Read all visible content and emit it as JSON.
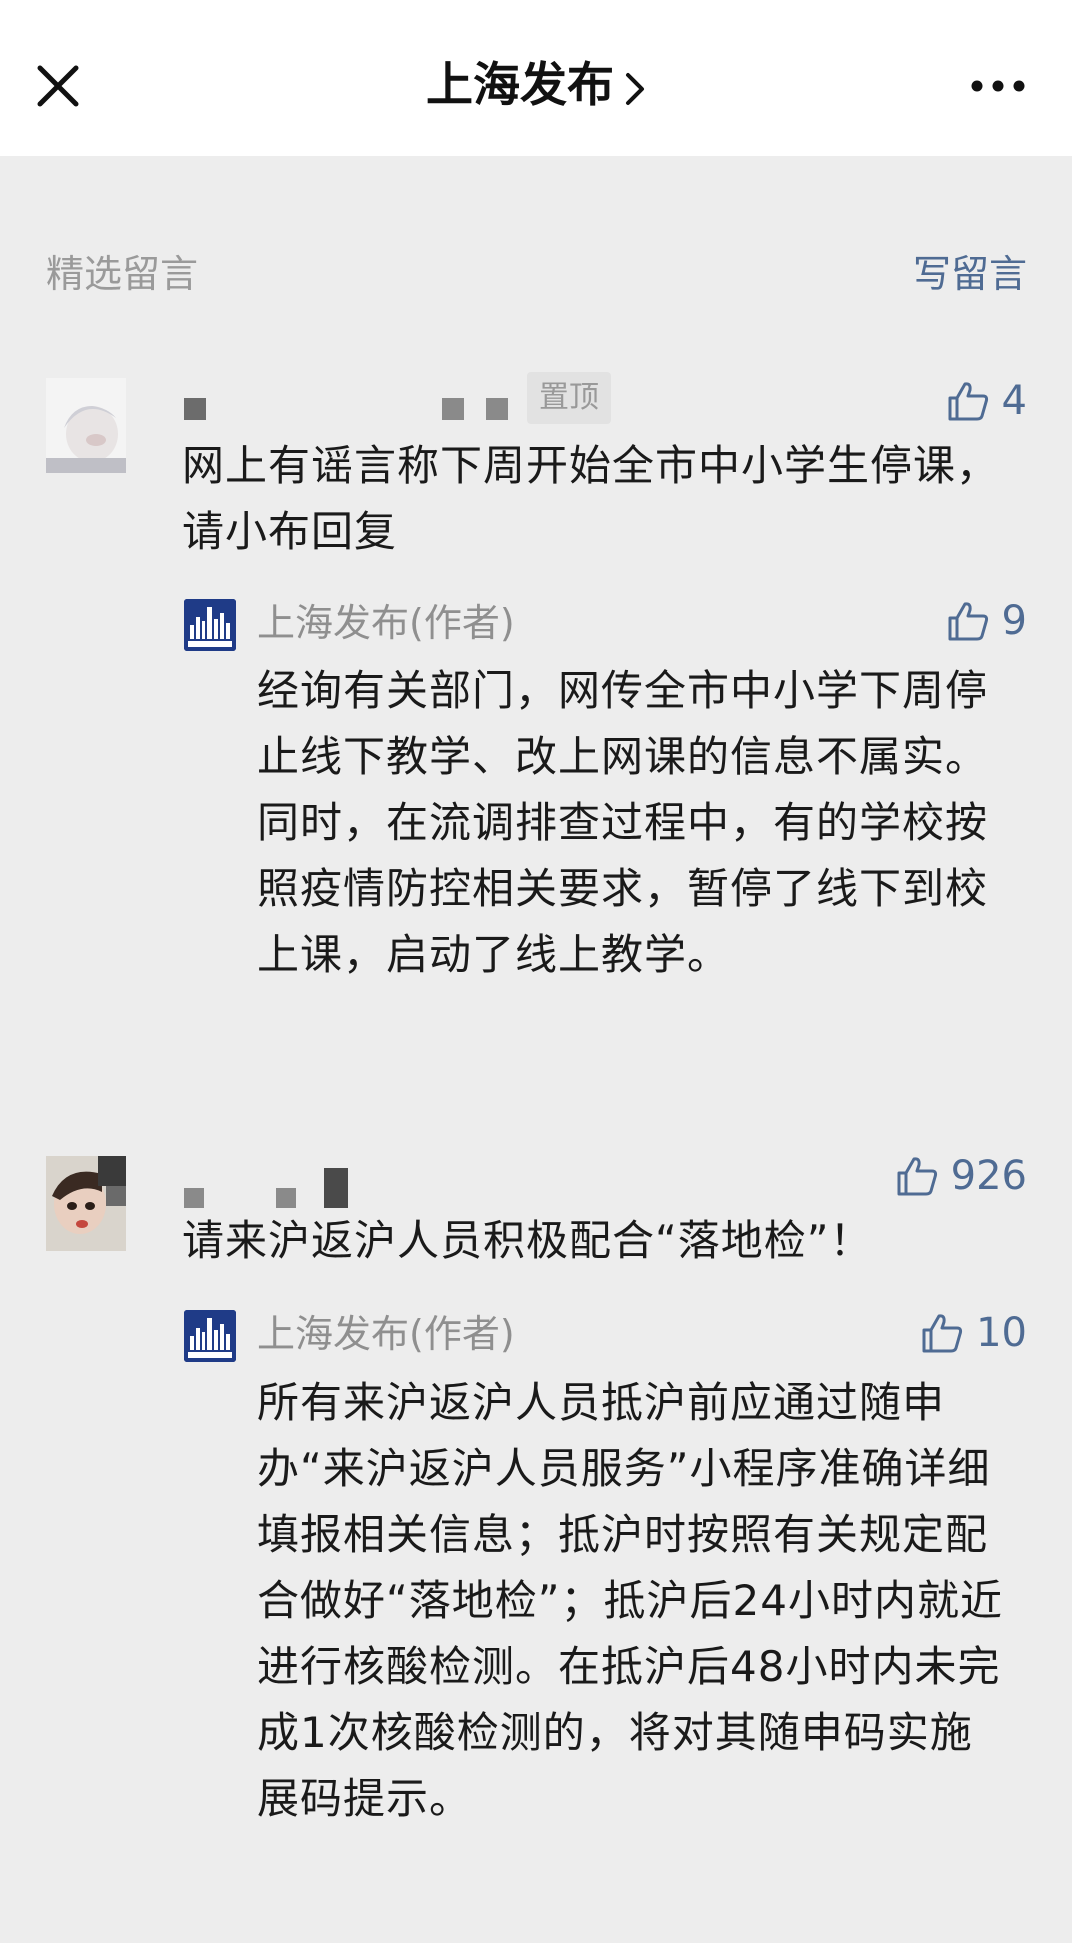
{
  "navbar": {
    "title": "上海发布",
    "close_icon": "close-icon",
    "chevron_icon": "chevron-right-icon",
    "more_icon": "more-icon"
  },
  "section": {
    "title": "精选留言",
    "write_label": "写留言"
  },
  "colors": {
    "accent": "#4f6b93",
    "background": "#ededed",
    "navbar": "#ffffff",
    "muted_text": "#9a9a9a",
    "logo_blue": "#1f3b87"
  },
  "comments": [
    {
      "pin_label": "置顶",
      "likes": "4",
      "text": "网上有谣言称下周开始全市中小学生停课，请小布回复",
      "reply": {
        "author": "上海发布(作者)",
        "likes": "9",
        "text": "经询有关部门，网传全市中小学下周停止线下教学、改上网课的信息不属实。同时，在流调排查过程中，有的学校按照疫情防控相关要求，暂停了线下到校上课，启动了线上教学。"
      }
    },
    {
      "likes": "926",
      "text": "请来沪返沪人员积极配合“落地检”！",
      "reply": {
        "author": "上海发布(作者)",
        "likes": "10",
        "text": "所有来沪返沪人员抵沪前应通过随申办“来沪返沪人员服务”小程序准确详细填报相关信息；抵沪时按照有关规定配合做好“落地检”；抵沪后24小时内就近进行核酸检测。在抵沪后48小时内未完成1次核酸检测的，将对其随申码实施展码提示。"
      }
    }
  ]
}
